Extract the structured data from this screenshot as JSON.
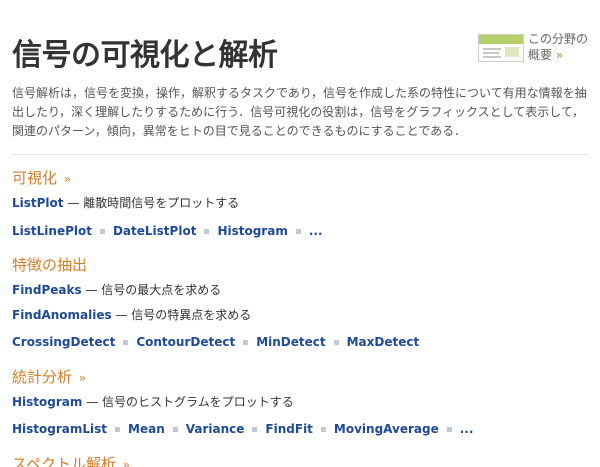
{
  "page": {
    "title": "信号の可視化と解析",
    "overview_label": "この分野の概要",
    "overview_arrow": "»",
    "intro": "信号解析は，信号を変換，操作，解釈するタスクであり，信号を作成した系の特性について有用な情報を抽出したり，深く理解したりするために行う．信号可視化の役割は，信号をグラフィックスとして表示して，関連のパターン，傾向，異常をヒトの目で見ることのできるものにすることである．"
  },
  "sections": [
    {
      "heading": "可視化",
      "more": "»",
      "items": [
        {
          "fn": "ListPlot",
          "desc": "離散時間信号をプロットする"
        }
      ],
      "links": [
        "ListLinePlot",
        "DateListPlot",
        "Histogram",
        "..."
      ]
    },
    {
      "heading": "特徴の抽出",
      "more": "",
      "items": [
        {
          "fn": "FindPeaks",
          "desc": "信号の最大点を求める"
        },
        {
          "fn": "FindAnomalies",
          "desc": "信号の特異点を求める"
        }
      ],
      "links": [
        "CrossingDetect",
        "ContourDetect",
        "MinDetect",
        "MaxDetect"
      ]
    },
    {
      "heading": "統計分析",
      "more": "»",
      "items": [
        {
          "fn": "Histogram",
          "desc": "信号のヒストグラムをプロットする"
        }
      ],
      "links": [
        "HistogramList",
        "Mean",
        "Variance",
        "FindFit",
        "MovingAverage",
        "..."
      ]
    },
    {
      "heading": "スペクトル解析",
      "more": "»",
      "items": [],
      "links": []
    }
  ],
  "colors": {
    "heading": "#d27f2c",
    "function_link": "#1f4a96",
    "text": "#333333",
    "separator": "#c2c9d6"
  },
  "icons": {
    "overview": "overview-thumbnail-icon",
    "separator": "square-bullet-icon"
  }
}
